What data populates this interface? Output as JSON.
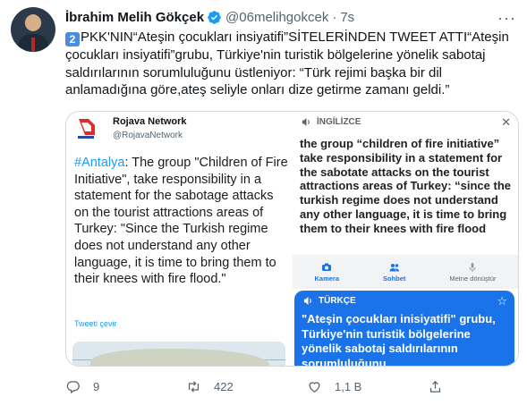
{
  "tweet": {
    "author_name": "İbrahim Melih Gökçek",
    "handle": "@06melihgokcek",
    "separator": "·",
    "time": "7s",
    "more_label": "···",
    "keycap": "2",
    "text": "PKK'NIN“Ateşin çocukları insiyatifi”SİTELERİNDEN TWEET ATTI“Ateşin çocukları insiyatifi”grubu, Türkiye'nin turistik bölgelerine yönelik sabotaj saldırılarının sorumluluğunu üstleniyor: “Türk rejimi başka bir dil anlamadığına göre,ateş seliyle onları dize getirme zamanı geldi.”"
  },
  "embedded_tweet": {
    "account_name": "Rojava Network",
    "account_handle": "@RojavaNetwork",
    "hashtag": "#Antalya",
    "body": ": The group \"Children of Fire Initiative\", take responsibility in a statement for the sabotage attacks on the tourist attractions areas of Turkey: \"Since the Turkish regime does not understand any other language, it is time to bring them to their knees with fire flood.\"",
    "translate_label": "Tweeti çevir"
  },
  "translator": {
    "source_lang": "İNGİLİZCE",
    "source_text": "the group “children of fire initiative” take responsibility in a statement for the sabotate attacks on the tourist attractions areas of Turkey: “since the turkish regime does not understand any other language, it is time to bring them to their knees with fire flood",
    "tools": [
      {
        "label": "Kamera",
        "icon": "camera-icon"
      },
      {
        "label": "Sohbet",
        "icon": "people-icon"
      },
      {
        "label": "Metne dönüştür",
        "icon": "mic-icon"
      }
    ],
    "target_lang": "TÜRKÇE",
    "target_text": "\"Ateşin çocukları inisiyatifi\" grubu, Türkiye'nin turistik bölgelerine yönelik sabotaj saldırılarının sorumluluğunu"
  },
  "actions": {
    "reply_count": "9",
    "retweet_count": "422",
    "like_count": "1,1 B"
  },
  "colors": {
    "accent": "#1d9bf0",
    "translate_blue": "#1a73e8",
    "muted": "#536471"
  }
}
